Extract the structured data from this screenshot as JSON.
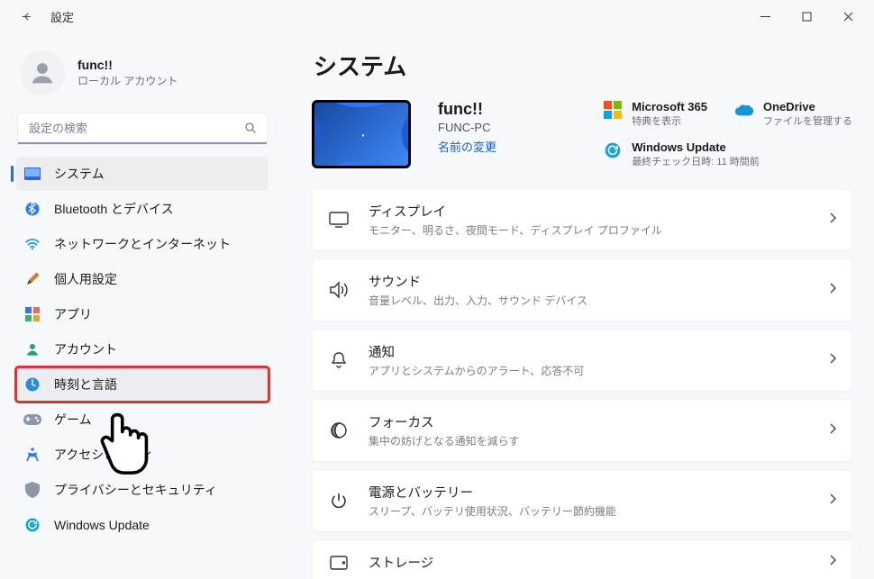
{
  "window": {
    "title": "設定"
  },
  "user": {
    "name": "func!!",
    "subtitle": "ローカル アカウント"
  },
  "search": {
    "placeholder": "設定の検索"
  },
  "sidebar": {
    "items": [
      {
        "id": "system",
        "label": "システム"
      },
      {
        "id": "bluetooth",
        "label": "Bluetooth とデバイス"
      },
      {
        "id": "network",
        "label": "ネットワークとインターネット"
      },
      {
        "id": "personal",
        "label": "個人用設定"
      },
      {
        "id": "apps",
        "label": "アプリ"
      },
      {
        "id": "account",
        "label": "アカウント"
      },
      {
        "id": "timelang",
        "label": "時刻と言語"
      },
      {
        "id": "game",
        "label": "ゲーム"
      },
      {
        "id": "accessibility",
        "label": "アクセシビリティ"
      },
      {
        "id": "privacy",
        "label": "プライバシーとセキュリティ"
      },
      {
        "id": "update",
        "label": "Windows Update"
      }
    ]
  },
  "page": {
    "title": "システム",
    "device_name": "func!!",
    "device_id": "FUNC-PC",
    "rename_link": "名前の変更"
  },
  "tiles": {
    "ms365": {
      "title": "Microsoft 365",
      "subtitle": "特典を表示"
    },
    "onedrive": {
      "title": "OneDrive",
      "subtitle": "ファイルを管理する"
    },
    "update": {
      "title": "Windows Update",
      "subtitle": "最終チェック日時: 11 時間前"
    }
  },
  "cards": [
    {
      "id": "display",
      "title": "ディスプレイ",
      "subtitle": "モニター、明るさ、夜間モード、ディスプレイ プロファイル"
    },
    {
      "id": "sound",
      "title": "サウンド",
      "subtitle": "音量レベル、出力、入力、サウンド デバイス"
    },
    {
      "id": "notif",
      "title": "通知",
      "subtitle": "アプリとシステムからのアラート、応答不可"
    },
    {
      "id": "focus",
      "title": "フォーカス",
      "subtitle": "集中の妨げとなる通知を減らす"
    },
    {
      "id": "power",
      "title": "電源とバッテリー",
      "subtitle": "スリープ、バッテリ使用状況、バッテリー節約機能"
    },
    {
      "id": "storage",
      "title": "ストレージ",
      "subtitle": ""
    }
  ]
}
